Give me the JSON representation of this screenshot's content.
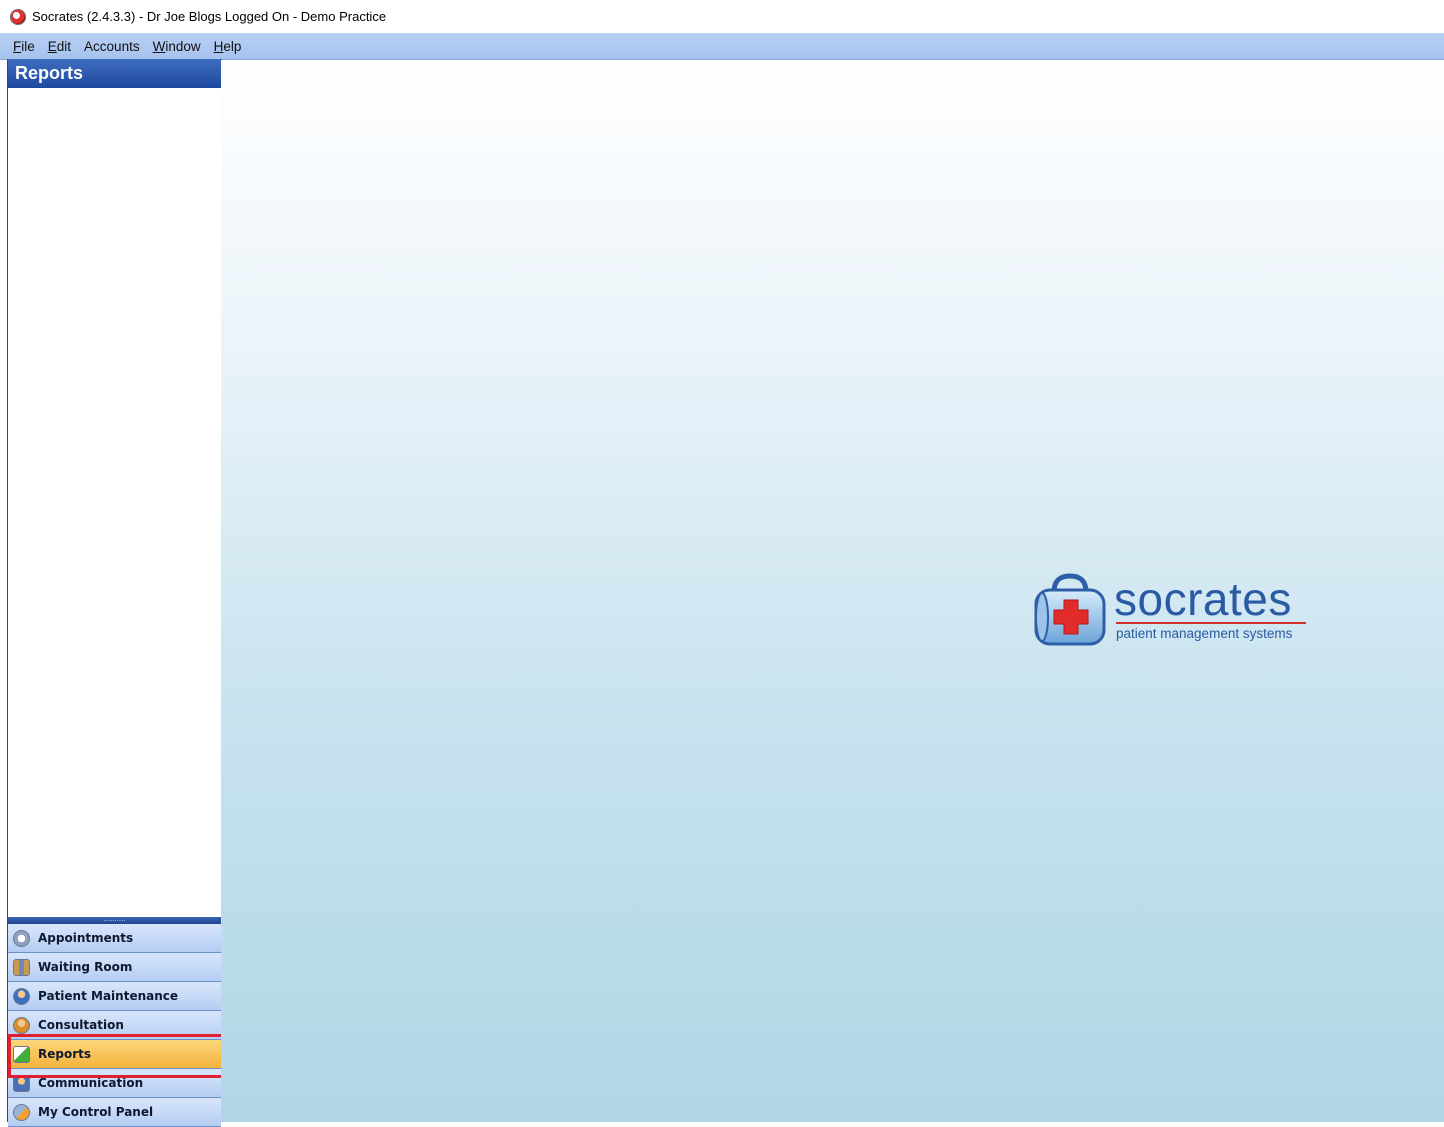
{
  "window": {
    "title": "Socrates (2.4.3.3) - Dr Joe Blogs Logged On - Demo Practice"
  },
  "menu": [
    {
      "mnemonic": "F",
      "rest": "ile"
    },
    {
      "mnemonic": "E",
      "rest": "dit"
    },
    {
      "mnemonic": "",
      "rest": "Accounts"
    },
    {
      "mnemonic": "W",
      "rest": "indow"
    },
    {
      "mnemonic": "H",
      "rest": "elp"
    }
  ],
  "sidebar": {
    "header": "Reports",
    "splitter_grip": "..........",
    "nav": [
      {
        "label": "Appointments",
        "icon": "appointments-icon"
      },
      {
        "label": "Waiting Room",
        "icon": "waiting-room-icon"
      },
      {
        "label": "Patient Maintenance",
        "icon": "patient-maintenance-icon"
      },
      {
        "label": "Consultation",
        "icon": "consultation-icon"
      },
      {
        "label": "Reports",
        "icon": "reports-icon",
        "active": true
      },
      {
        "label": "Communication",
        "icon": "communication-icon"
      },
      {
        "label": "My Control Panel",
        "icon": "control-panel-icon"
      }
    ]
  },
  "logo": {
    "wordmark": "socrates",
    "tagline": "patient management systems"
  },
  "colors": {
    "highlight": "#e0202e",
    "active_nav": "#f5b23c",
    "header_blue": "#1d4aa0",
    "brand_blue": "#2a5aa4"
  }
}
